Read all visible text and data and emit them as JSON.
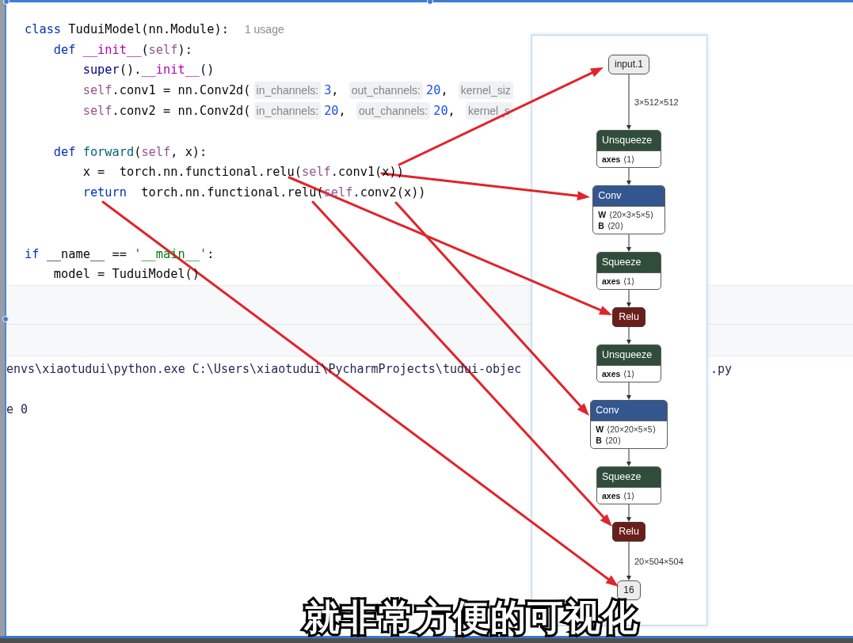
{
  "editor": {
    "lines": [
      {
        "kind": "code",
        "parts": [
          {
            "kind": "code",
            "tokens": [
              {
                "kind": "keyword",
                "text": "class"
              },
              {
                "kind": "plain",
                "text": " TuduiModel(nn.Module):"
              }
            ]
          },
          {
            "kind": "usage",
            "text": "1 usage"
          }
        ]
      },
      {
        "kind": "code",
        "parts": [
          {
            "kind": "code",
            "tokens": [
              {
                "kind": "keyword",
                "text": "    def "
              },
              {
                "kind": "dunder",
                "text": "__init__"
              },
              {
                "kind": "plain",
                "text": "("
              },
              {
                "kind": "self",
                "text": "self"
              },
              {
                "kind": "plain",
                "text": "):"
              }
            ]
          }
        ]
      },
      {
        "kind": "code",
        "parts": [
          {
            "kind": "code",
            "tokens": [
              {
                "kind": "builtin",
                "text": "        super"
              },
              {
                "kind": "plain",
                "text": "()."
              },
              {
                "kind": "dunder",
                "text": "__init__"
              },
              {
                "kind": "plain",
                "text": "()"
              }
            ]
          }
        ]
      },
      {
        "kind": "code",
        "parts": [
          {
            "kind": "code",
            "tokens": [
              {
                "kind": "self",
                "text": "        self"
              },
              {
                "kind": "plain",
                "text": ".conv1 = nn.Conv2d("
              }
            ]
          },
          {
            "kind": "hint",
            "text": "in_channels:"
          },
          {
            "kind": "code",
            "tokens": [
              {
                "kind": "number",
                "text": "3"
              },
              {
                "kind": "plain",
                "text": ", "
              }
            ]
          },
          {
            "kind": "hint",
            "text": "out_channels:"
          },
          {
            "kind": "code",
            "tokens": [
              {
                "kind": "number",
                "text": "20"
              },
              {
                "kind": "plain",
                "text": ", "
              }
            ]
          },
          {
            "kind": "hint",
            "text": "kernel_siz"
          }
        ]
      },
      {
        "kind": "code",
        "parts": [
          {
            "kind": "code",
            "tokens": [
              {
                "kind": "self",
                "text": "        self"
              },
              {
                "kind": "plain",
                "text": ".conv2 = nn.Conv2d("
              }
            ]
          },
          {
            "kind": "hint",
            "text": "in_channels:"
          },
          {
            "kind": "code",
            "tokens": [
              {
                "kind": "number",
                "text": "20"
              },
              {
                "kind": "plain",
                "text": ", "
              }
            ]
          },
          {
            "kind": "hint",
            "text": "out_channels:"
          },
          {
            "kind": "code",
            "tokens": [
              {
                "kind": "number",
                "text": "20"
              },
              {
                "kind": "plain",
                "text": ", "
              }
            ]
          },
          {
            "kind": "hint",
            "text": "kernel_s"
          }
        ]
      },
      {
        "kind": "blank"
      },
      {
        "kind": "code",
        "parts": [
          {
            "kind": "code",
            "tokens": [
              {
                "kind": "keyword",
                "text": "    def "
              },
              {
                "kind": "func",
                "text": "forward"
              },
              {
                "kind": "plain",
                "text": "("
              },
              {
                "kind": "self",
                "text": "self"
              },
              {
                "kind": "plain",
                "text": ", x):"
              }
            ]
          }
        ]
      },
      {
        "kind": "code",
        "parts": [
          {
            "kind": "code",
            "tokens": [
              {
                "kind": "plain",
                "text": "        x =  torch.nn.functional.relu("
              },
              {
                "kind": "self",
                "text": "self"
              },
              {
                "kind": "plain",
                "text": ".conv1(x))"
              }
            ]
          }
        ]
      },
      {
        "kind": "code",
        "parts": [
          {
            "kind": "code",
            "tokens": [
              {
                "kind": "keyword",
                "text": "        return"
              },
              {
                "kind": "plain",
                "text": "  torch.nn.functional.relu("
              },
              {
                "kind": "self",
                "text": "self"
              },
              {
                "kind": "plain",
                "text": ".conv2(x))"
              }
            ]
          }
        ]
      },
      {
        "kind": "blank"
      },
      {
        "kind": "blank"
      },
      {
        "kind": "code",
        "parts": [
          {
            "kind": "code",
            "tokens": [
              {
                "kind": "keyword",
                "text": "if"
              },
              {
                "kind": "plain",
                "text": " __name__ == "
              },
              {
                "kind": "string",
                "text": "'__main__'"
              },
              {
                "kind": "plain",
                "text": ":"
              }
            ]
          }
        ]
      },
      {
        "kind": "code",
        "parts": [
          {
            "kind": "code",
            "tokens": [
              {
                "kind": "plain",
                "text": "    model = TuduiModel()"
              }
            ]
          }
        ]
      }
    ]
  },
  "console": {
    "lines": [
      {
        "kind": "text",
        "segments": [
          "envs\\xiaotudui\\python.exe C:\\Users\\xiaotudui\\PycharmProjects\\tudui-objec",
          ".py"
        ]
      },
      {
        "kind": "blank"
      },
      {
        "kind": "text",
        "segments": [
          "e 0"
        ]
      }
    ]
  },
  "graph": {
    "nodes": [
      {
        "kind": "input",
        "name": "input.1",
        "edge_label": "3×512×512"
      },
      {
        "kind": "op",
        "name": "Unsqueeze",
        "color": "#304d3b",
        "attributes": [
          {
            "name": "axes",
            "value": "⟨1⟩"
          }
        ]
      },
      {
        "kind": "op",
        "name": "Conv",
        "color": "#34568f",
        "attributes": [
          {
            "name": "W",
            "value": "⟨20×3×5×5⟩"
          },
          {
            "name": "B",
            "value": "⟨20⟩"
          }
        ]
      },
      {
        "kind": "op",
        "name": "Squeeze",
        "color": "#304d3b",
        "attributes": [
          {
            "name": "axes",
            "value": "⟨1⟩"
          }
        ]
      },
      {
        "kind": "op",
        "name": "Relu",
        "color": "#6b1f1a"
      },
      {
        "kind": "op",
        "name": "Unsqueeze",
        "color": "#304d3b",
        "attributes": [
          {
            "name": "axes",
            "value": "⟨1⟩"
          }
        ]
      },
      {
        "kind": "op",
        "name": "Conv",
        "color": "#34568f",
        "attributes": [
          {
            "name": "W",
            "value": "⟨20×20×5×5⟩"
          },
          {
            "name": "B",
            "value": "⟨20⟩"
          }
        ]
      },
      {
        "kind": "op",
        "name": "Squeeze",
        "color": "#304d3b",
        "attributes": [
          {
            "name": "axes",
            "value": "⟨1⟩"
          }
        ]
      },
      {
        "kind": "op",
        "name": "Relu",
        "color": "#6b1f1a",
        "edge_label": "20×504×504"
      },
      {
        "kind": "output",
        "name": "16"
      }
    ]
  },
  "annotation_arrows": true,
  "subtitle": "就非常方便的可视化"
}
